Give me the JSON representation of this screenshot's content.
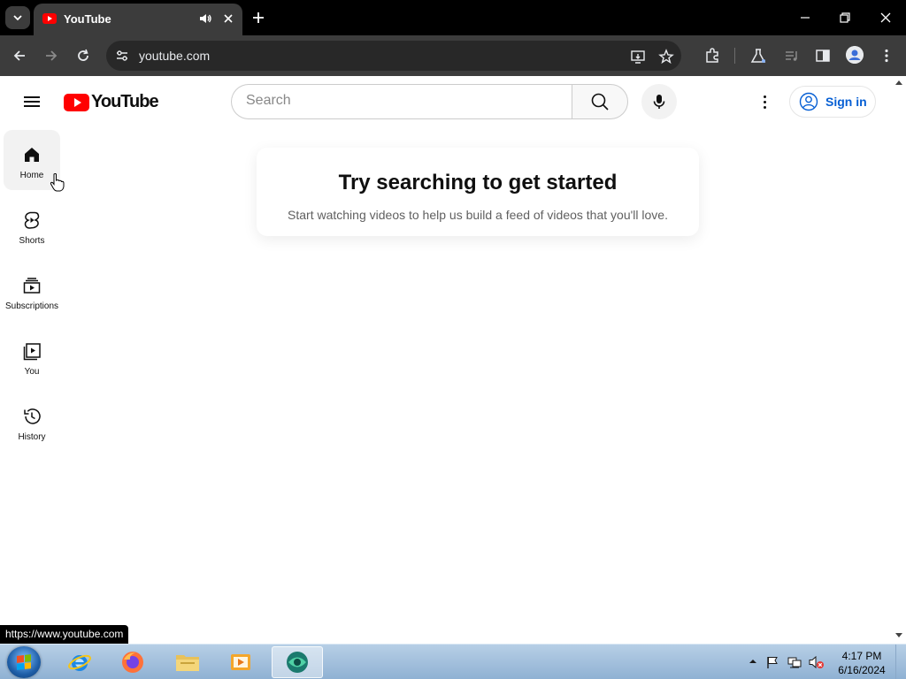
{
  "browser": {
    "tab_title": "YouTube",
    "url": "youtube.com",
    "icons": {
      "tab_search": "chevron-down-icon",
      "audio": "speaker-icon",
      "tab_close": "close-icon",
      "new_tab": "plus-icon",
      "back": "back-arrow-icon",
      "forward": "forward-arrow-icon",
      "reload": "reload-icon",
      "site_info": "tune-icon",
      "cast": "install-app-icon",
      "bookmark": "star-icon",
      "extensions": "puzzle-icon",
      "labs": "flask-icon",
      "media": "media-control-icon",
      "side_panel": "side-panel-icon",
      "profile": "profile-icon",
      "menu": "kebab-menu-icon"
    }
  },
  "youtube": {
    "logo_text": "YouTube",
    "search_placeholder": "Search",
    "signin_label": "Sign in",
    "guide": [
      {
        "label": "Home",
        "icon": "home-icon",
        "active": true
      },
      {
        "label": "Shorts",
        "icon": "shorts-icon",
        "active": false
      },
      {
        "label": "Subscriptions",
        "icon": "subscriptions-icon",
        "active": false
      },
      {
        "label": "You",
        "icon": "you-library-icon",
        "active": false
      },
      {
        "label": "History",
        "icon": "history-icon",
        "active": false
      }
    ],
    "empty_state": {
      "title": "Try searching to get started",
      "subtitle": "Start watching videos to help us build a feed of videos that you'll love."
    }
  },
  "status_bar_url": "https://www.youtube.com",
  "taskbar": {
    "apps": [
      "internet-explorer-icon",
      "firefox-icon",
      "file-explorer-icon",
      "media-player-icon",
      "active-app-icon"
    ],
    "clock_time": "4:17 PM",
    "clock_date": "6/16/2024"
  },
  "colors": {
    "youtube_red": "#ff0000",
    "link_blue": "#065fd4",
    "chrome_dark": "#3c3c3c"
  }
}
